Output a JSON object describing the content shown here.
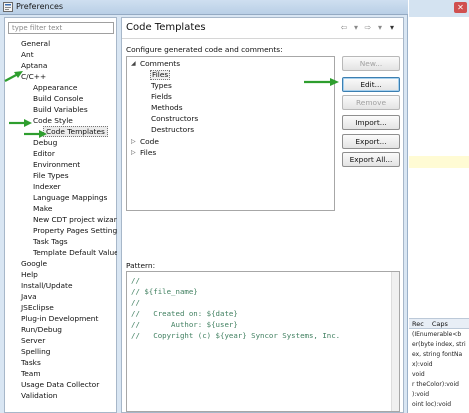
{
  "window": {
    "title": "Preferences"
  },
  "filter": {
    "placeholder": "type filter text"
  },
  "left_tree": [
    {
      "label": "General"
    },
    {
      "label": "Ant"
    },
    {
      "label": "Aptana"
    },
    {
      "label": "C/C++"
    },
    {
      "label": "Appearance"
    },
    {
      "label": "Build Console"
    },
    {
      "label": "Build Variables"
    },
    {
      "label": "Code Style"
    },
    {
      "label": "Code Templates"
    },
    {
      "label": "Debug"
    },
    {
      "label": "Editor"
    },
    {
      "label": "Environment"
    },
    {
      "label": "File Types"
    },
    {
      "label": "Indexer"
    },
    {
      "label": "Language Mappings"
    },
    {
      "label": "Make"
    },
    {
      "label": "New CDT project wizard"
    },
    {
      "label": "Property Pages Settings"
    },
    {
      "label": "Task Tags"
    },
    {
      "label": "Template Default Value"
    },
    {
      "label": "Google"
    },
    {
      "label": "Help"
    },
    {
      "label": "Install/Update"
    },
    {
      "label": "Java"
    },
    {
      "label": "JSEclipse"
    },
    {
      "label": "Plug-in Development"
    },
    {
      "label": "Run/Debug"
    },
    {
      "label": "Server"
    },
    {
      "label": "Spelling"
    },
    {
      "label": "Tasks"
    },
    {
      "label": "Team"
    },
    {
      "label": "Usage Data Collector"
    },
    {
      "label": "Validation"
    }
  ],
  "page": {
    "title": "Code Templates",
    "configure_text": "Configure generated code and comments:"
  },
  "templates_tree": [
    {
      "label": "Comments"
    },
    {
      "label": "Files"
    },
    {
      "label": "Types"
    },
    {
      "label": "Fields"
    },
    {
      "label": "Methods"
    },
    {
      "label": "Constructors"
    },
    {
      "label": "Destructors"
    },
    {
      "label": "Code"
    },
    {
      "label": "Files"
    }
  ],
  "buttons": {
    "new": "New...",
    "edit": "Edit...",
    "remove": "Remove",
    "import": "Import...",
    "export": "Export...",
    "export_all": "Export All..."
  },
  "pattern": {
    "label": "Pattern:",
    "lines": [
      "//",
      "// ${file_name}",
      "//",
      "//   Created on: ${date}",
      "//       Author: ${user}",
      "//   Copyright (c) ${year} Syncor Systems, Inc."
    ]
  },
  "background_editor": {
    "tabs": [
      "Rec",
      "Caps"
    ],
    "code_lines": [
      "(IEnumerable<b",
      "er(byte index, stri",
      "ex, string fontNa",
      "x):void",
      "void",
      "r theColor):void",
      "):void",
      "oint loc):void"
    ]
  },
  "colors": {
    "arrow": "#2e9e2e",
    "comment": "#3f7f5f",
    "window_bg": "#d9e6f3"
  }
}
